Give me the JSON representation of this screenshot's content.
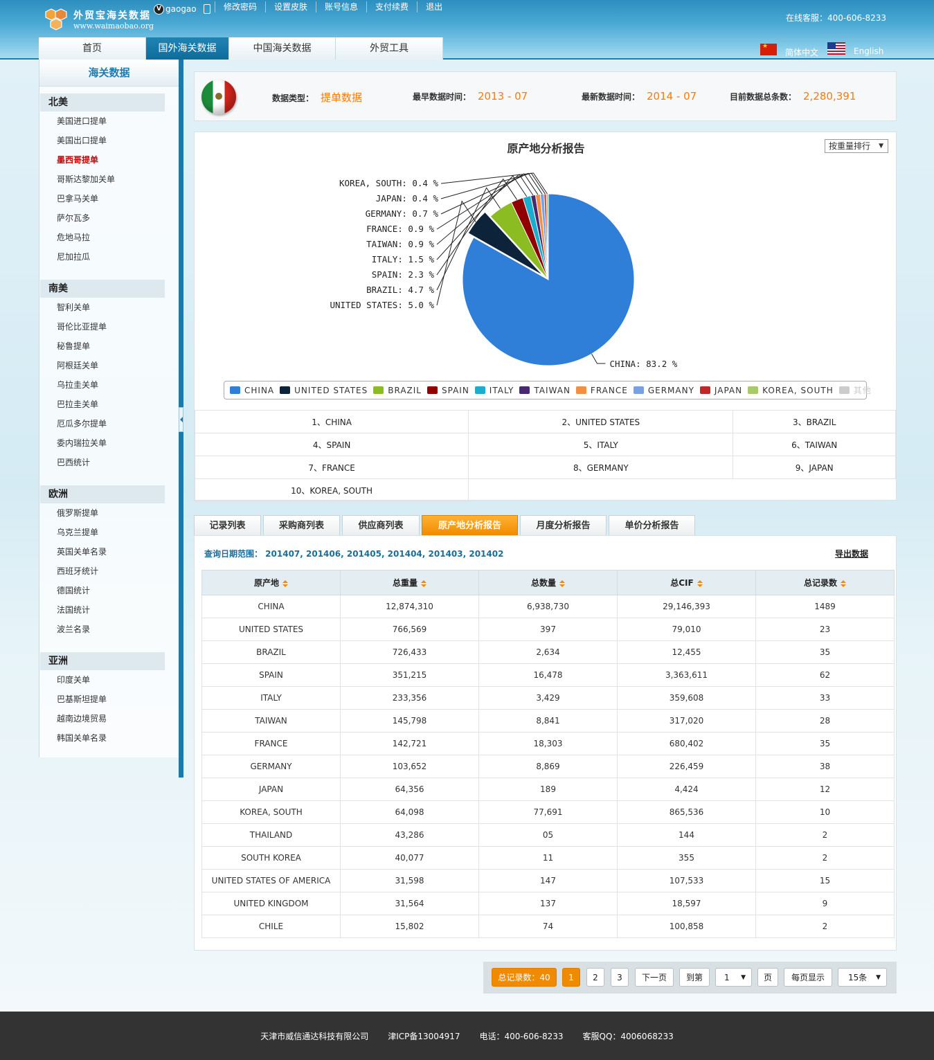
{
  "header": {
    "logo_title": "外贸宝海关数据",
    "logo_url": "www.waimaobao.org",
    "username": "gaogao",
    "top_links": [
      "修改密码",
      "设置皮肤",
      "账号信息",
      "支付续费",
      "退出"
    ],
    "hotline": "在线客服：400-606-8233",
    "lang_cn": "简体中文",
    "lang_en": "English"
  },
  "nav": {
    "tabs": [
      {
        "label": "首页",
        "active": false
      },
      {
        "label": "国外海关数据",
        "active": true
      },
      {
        "label": "中国海关数据",
        "active": false
      },
      {
        "label": "外贸工具",
        "active": false
      }
    ]
  },
  "sidebar": {
    "title": "海关数据",
    "groups": [
      {
        "name": "北美",
        "items": [
          "美国进口提单",
          "美国出口提单",
          "墨西哥提单",
          "哥斯达黎加关单",
          "巴拿马关单",
          "萨尔瓦多",
          "危地马拉",
          "尼加拉瓜"
        ]
      },
      {
        "name": "南美",
        "items": [
          "智利关单",
          "哥伦比亚提单",
          "秘鲁提单",
          "阿根廷关单",
          "乌拉圭关单",
          "巴拉圭关单",
          "厄瓜多尔提单",
          "委内瑞拉关单",
          "巴西统计"
        ]
      },
      {
        "name": "欧洲",
        "items": [
          "俄罗斯提单",
          "乌克兰提单",
          "英国关单名录",
          "西班牙统计",
          "德国统计",
          "法国统计",
          "波兰名录"
        ]
      },
      {
        "name": "亚洲",
        "items": [
          "印度关单",
          "巴基斯坦提单",
          "越南边境贸易",
          "韩国关单名录"
        ]
      }
    ],
    "active_item": "墨西哥提单"
  },
  "info": {
    "type_label": "数据类型：",
    "type_value": "提单数据",
    "earliest_label": "最早数据时间：",
    "earliest_value": "2013 - 07",
    "latest_label": "最新数据时间：",
    "latest_value": "2014 - 07",
    "total_label": "目前数据总条数：",
    "total_value": "2,280,391"
  },
  "report": {
    "title": "原产地分析报告",
    "sort_select": "按重量排行",
    "ranking": [
      "1、CHINA",
      "2、UNITED STATES",
      "3、BRAZIL",
      "4、SPAIN",
      "5、ITALY",
      "6、TAIWAN",
      "7、FRANCE",
      "8、GERMANY",
      "9、JAPAN",
      "10、KOREA, SOUTH"
    ]
  },
  "chart_data": {
    "type": "pie",
    "title": "原产地分析报告",
    "legend_placement": "bottom",
    "slices": [
      {
        "label": "CHINA",
        "value": 83.2,
        "display": "83.2 %",
        "color": "#2f7ed8"
      },
      {
        "label": "UNITED STATES",
        "value": 5.0,
        "display": "5.0 %",
        "color": "#0d233a"
      },
      {
        "label": "BRAZIL",
        "value": 4.7,
        "display": "4.7 %",
        "color": "#8bbc21"
      },
      {
        "label": "SPAIN",
        "value": 2.3,
        "display": "2.3 %",
        "color": "#910000"
      },
      {
        "label": "ITALY",
        "value": 1.5,
        "display": "1.5 %",
        "color": "#1aadce"
      },
      {
        "label": "TAIWAN",
        "value": 0.9,
        "display": "0.9 %",
        "color": "#492970"
      },
      {
        "label": "FRANCE",
        "value": 0.9,
        "display": "0.9 %",
        "color": "#f28f43"
      },
      {
        "label": "GERMANY",
        "value": 0.7,
        "display": "0.7 %",
        "color": "#77a1e5"
      },
      {
        "label": "JAPAN",
        "value": 0.4,
        "display": "0.4 %",
        "color": "#c42525"
      },
      {
        "label": "KOREA, SOUTH",
        "value": 0.4,
        "display": "0.4 %",
        "color": "#a6c96a"
      }
    ],
    "legend_extra": "其他"
  },
  "tabs": {
    "items": [
      "记录列表",
      "采购商列表",
      "供应商列表",
      "原产地分析报告",
      "月度分析报告",
      "单价分析报告"
    ],
    "active": "原产地分析报告"
  },
  "table": {
    "query_range": "查询日期范围： 201407, 201406, 201405, 201404, 201403, 201402",
    "export": "导出数据",
    "headers": [
      "原产地",
      "总重量",
      "总数量",
      "总CIF",
      "总记录数"
    ],
    "rows": [
      [
        "CHINA",
        "12,874,310",
        "6,938,730",
        "29,146,393",
        "1489"
      ],
      [
        "UNITED STATES",
        "766,569",
        "397",
        "79,010",
        "23"
      ],
      [
        "BRAZIL",
        "726,433",
        "2,634",
        "12,455",
        "35"
      ],
      [
        "SPAIN",
        "351,215",
        "16,478",
        "3,363,611",
        "62"
      ],
      [
        "ITALY",
        "233,356",
        "3,429",
        "359,608",
        "33"
      ],
      [
        "TAIWAN",
        "145,798",
        "8,841",
        "317,020",
        "28"
      ],
      [
        "FRANCE",
        "142,721",
        "18,303",
        "680,402",
        "35"
      ],
      [
        "GERMANY",
        "103,652",
        "8,869",
        "226,459",
        "38"
      ],
      [
        "JAPAN",
        "64,356",
        "189",
        "4,424",
        "12"
      ],
      [
        "KOREA, SOUTH",
        "64,098",
        "77,691",
        "865,536",
        "10"
      ],
      [
        "THAILAND",
        "43,286",
        "05",
        "144",
        "2"
      ],
      [
        "SOUTH KOREA",
        "40,077",
        "11",
        "355",
        "2"
      ],
      [
        "UNITED STATES OF AMERICA",
        "31,598",
        "147",
        "107,533",
        "15"
      ],
      [
        "UNITED KINGDOM",
        "31,564",
        "137",
        "18,597",
        "9"
      ],
      [
        "CHILE",
        "15,802",
        "74",
        "100,858",
        "2"
      ]
    ]
  },
  "pager": {
    "total": "总记录数：40",
    "pages": [
      "1",
      "2",
      "3"
    ],
    "current": "1",
    "next": "下一页",
    "goto": "到第",
    "goto_value": "1",
    "page_unit": "页",
    "per_page_label": "每页显示",
    "per_page_value": "15条"
  },
  "footer": {
    "company": "天津市威信通达科技有限公司",
    "icp": "津ICP备13004917",
    "phone": "电话：400-606-8233",
    "qq": "客服QQ：4006068233"
  }
}
